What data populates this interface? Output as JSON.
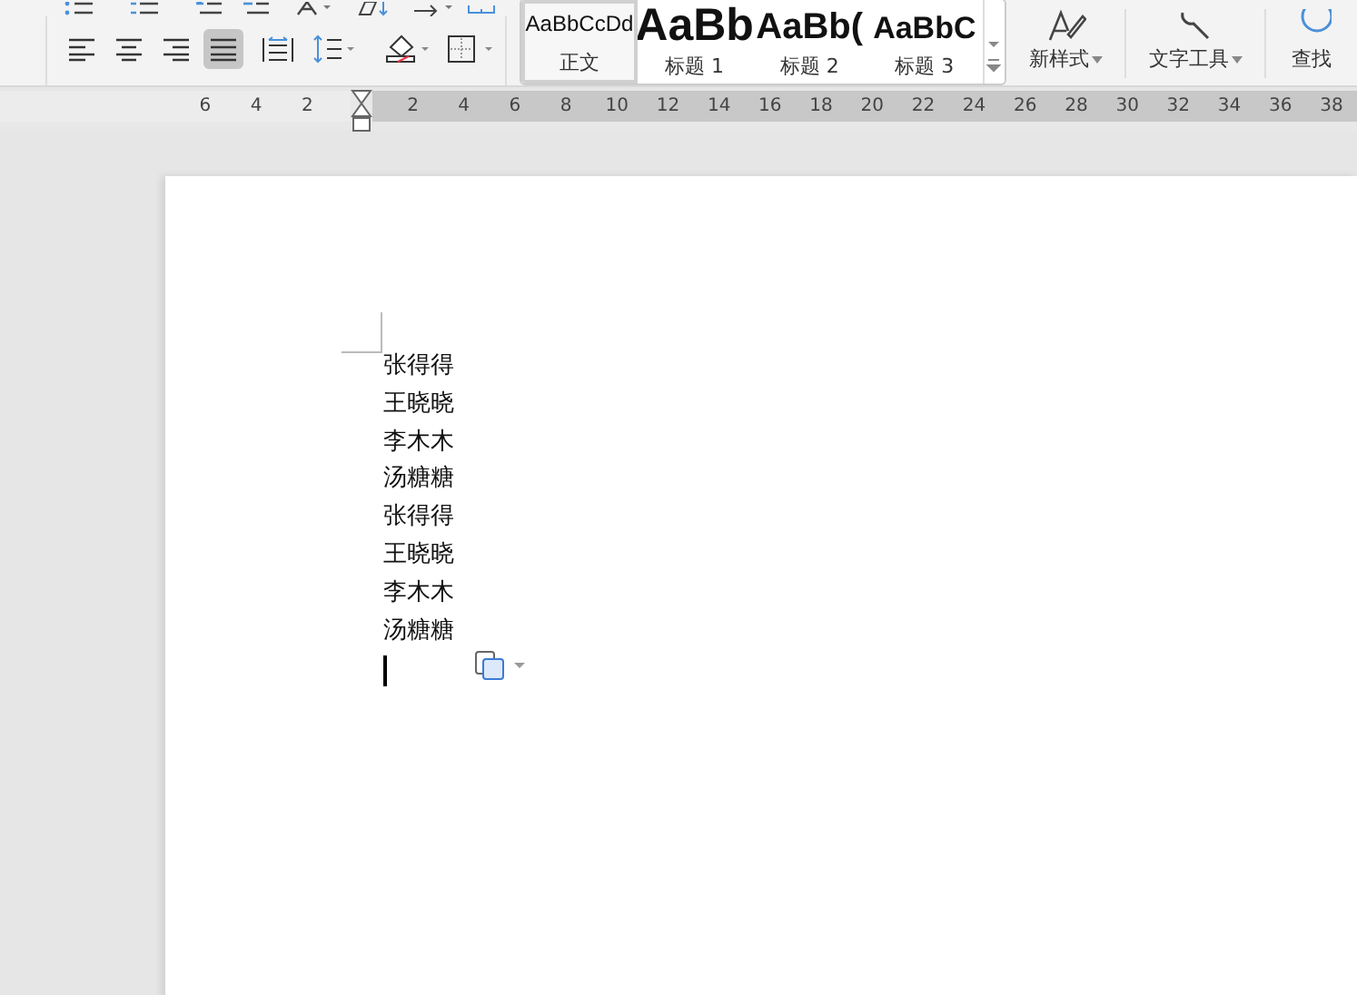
{
  "ribbon": {
    "alignment_buttons": [
      {
        "selected": false
      },
      {
        "selected": false
      },
      {
        "selected": false
      },
      {
        "selected": true
      }
    ],
    "style_gallery": [
      {
        "sample": "AaBbCcDd",
        "label": "正文",
        "kind": "body",
        "selected": true
      },
      {
        "sample": "AaBb",
        "label": "标题 1",
        "kind": "h1",
        "selected": false
      },
      {
        "sample": "AaBb(",
        "label": "标题 2",
        "kind": "h2",
        "selected": false
      },
      {
        "sample": "AaBbC",
        "label": "标题 3",
        "kind": "h3",
        "selected": false
      }
    ],
    "new_style": "新样式",
    "text_tools": "文字工具",
    "find": "查找"
  },
  "ruler": {
    "left_ticks": [
      "6",
      "4",
      "2"
    ],
    "right_ticks": [
      "2",
      "4",
      "6",
      "8",
      "10",
      "12",
      "14",
      "16",
      "18",
      "20",
      "22",
      "24",
      "26",
      "28",
      "30",
      "32",
      "34",
      "36",
      "38"
    ]
  },
  "document": {
    "lines": [
      "张得得",
      "王晓晓",
      "李木木",
      "汤糖糖",
      "张得得",
      "王晓晓",
      "李木木",
      "汤糖糖"
    ]
  }
}
